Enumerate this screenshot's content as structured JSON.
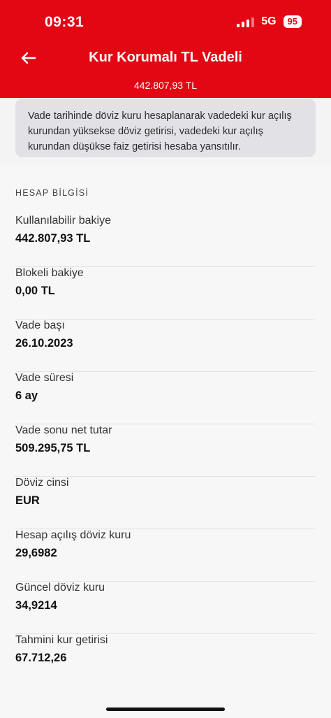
{
  "status": {
    "time": "09:31",
    "network": "5G",
    "battery": "95"
  },
  "header": {
    "title": "Kur Korumalı TL Vadeli",
    "balance": "442.807,93 TL"
  },
  "info": {
    "text": "Vade tarihinde döviz kuru hesaplanarak vadedeki kur açılış kurundan yüksekse döviz getirisi, vadedeki kur açılış kurundan düşükse faiz getirisi hesaba yansıtılır."
  },
  "section": {
    "title": "HESAP BİLGİSİ"
  },
  "rows": [
    {
      "label": "Kullanılabilir bakiye",
      "value": "442.807,93 TL"
    },
    {
      "label": "Blokeli bakiye",
      "value": "0,00 TL"
    },
    {
      "label": "Vade başı",
      "value": "26.10.2023"
    },
    {
      "label": "Vade süresi",
      "value": "6 ay"
    },
    {
      "label": "Vade sonu net tutar",
      "value": "509.295,75 TL"
    },
    {
      "label": "Döviz cinsi",
      "value": "EUR"
    },
    {
      "label": "Hesap açılış döviz kuru",
      "value": "29,6982"
    },
    {
      "label": "Güncel döviz kuru",
      "value": "34,9214"
    },
    {
      "label": "Tahmini kur getirisi",
      "value": "67.712,26"
    }
  ],
  "colors": {
    "brand": "#e30613"
  }
}
